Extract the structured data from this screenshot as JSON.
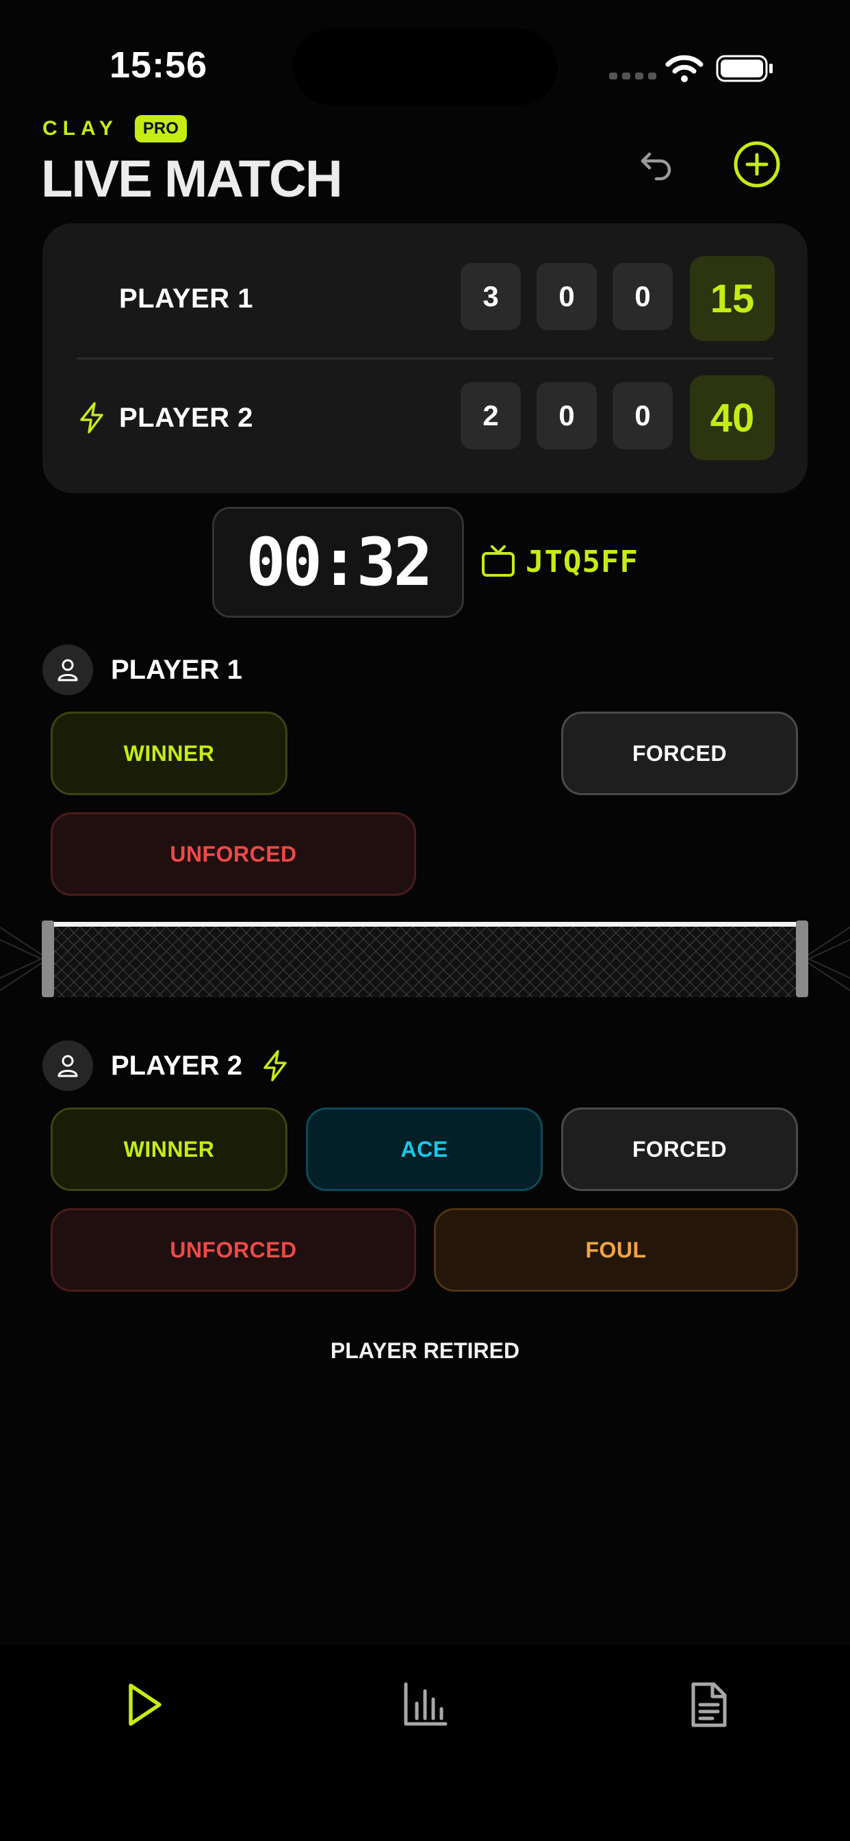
{
  "status": {
    "time": "15:56"
  },
  "header": {
    "brand": "CLAY",
    "badge": "PRO",
    "title": "LIVE MATCH"
  },
  "scoreboard": {
    "players": [
      {
        "name": "PLAYER 1",
        "serving": false,
        "sets": [
          "3",
          "0",
          "0"
        ],
        "points": "15"
      },
      {
        "name": "PLAYER 2",
        "serving": true,
        "sets": [
          "2",
          "0",
          "0"
        ],
        "points": "40"
      }
    ]
  },
  "timer": {
    "value": "00:32"
  },
  "stream": {
    "code": "JTQ5FF",
    "icon": "tv-icon"
  },
  "player1_panel": {
    "name": "PLAYER 1",
    "buttons": {
      "winner": "WINNER",
      "forced": "FORCED",
      "unforced": "UNFORCED"
    }
  },
  "player2_panel": {
    "name": "PLAYER 2",
    "serving": true,
    "buttons": {
      "winner": "WINNER",
      "ace": "ACE",
      "forced": "FORCED",
      "unforced": "UNFORCED",
      "foul": "FOUL"
    }
  },
  "retired_label": "PLAYER RETIRED",
  "tabbar": {
    "tabs": [
      "play-icon",
      "stats-icon",
      "document-icon"
    ],
    "active": "play-icon"
  },
  "colors": {
    "accent": "#c6ec16",
    "error": "#ee4a46",
    "ace": "#17c8ea",
    "foul": "#f4a540",
    "background": "#050505"
  }
}
